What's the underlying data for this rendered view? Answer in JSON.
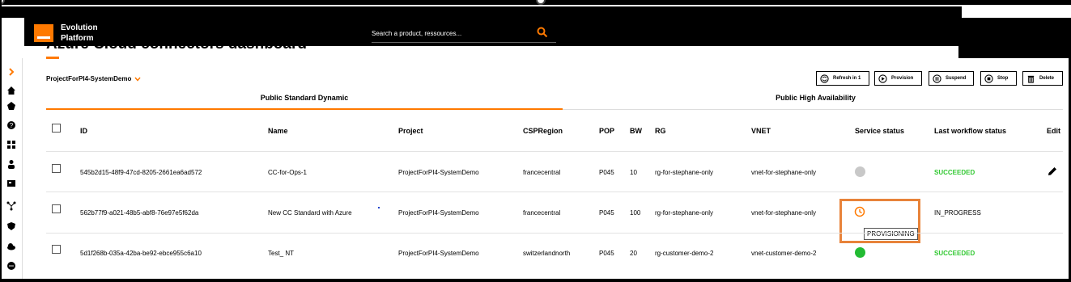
{
  "app": {
    "name_line1": "Evolution",
    "name_line2": "Platform",
    "search_placeholder": "Search a product, ressources..."
  },
  "page": {
    "title": "Azure Cloud connectors dashboard",
    "project": "ProjectForPI4-SystemDemo"
  },
  "actions": {
    "refresh": "Refresh in 1",
    "provision": "Provision",
    "suspend": "Suspend",
    "stop": "Stop",
    "delete": "Delete"
  },
  "tabs": [
    "Public Standard Dynamic",
    "Public High Availability"
  ],
  "table": {
    "headers": {
      "id": "ID",
      "name": "Name",
      "project": "Project",
      "region": "CSPRegion",
      "pop": "POP",
      "bw": "BW",
      "rg": "RG",
      "vnet": "VNET",
      "service_status": "Service status",
      "workflow_status": "Last workflow status",
      "edit": "Edit"
    },
    "rows": [
      {
        "id": "545b2d15-48f9-47cd-8205-2661ea6ad572",
        "name": "CC-for-Ops-1",
        "project": "ProjectForPI4-SystemDemo",
        "region": "francecentral",
        "pop": "P045",
        "bw": "10",
        "rg": "rg-for-stephane-only",
        "vnet": "vnet-for-stephane-only",
        "service_status_color": "#c8c8c8",
        "workflow_status": "SUCCEEDED"
      },
      {
        "id": "562b77f9-a021-48b5-abf8-76e97e5f62da",
        "name": "New CC Standard with Azure",
        "project": "ProjectForPI4-SystemDemo",
        "region": "francecentral",
        "pop": "P045",
        "bw": "100",
        "rg": "rg-for-stephane-only",
        "vnet": "vnet-for-stephane-only",
        "service_status_tooltip": "PROVISIONING",
        "workflow_status": "IN_PROGRESS"
      },
      {
        "id": "5d1f268b-035a-42ba-be92-ebce955c6a10",
        "name": "Test_ NT",
        "project": "ProjectForPI4-SystemDemo",
        "region": "switzerlandnorth",
        "pop": "P045",
        "bw": "20",
        "rg": "rg-customer-demo-2",
        "vnet": "vnet-customer-demo-2",
        "service_status_color": "#22bb33",
        "workflow_status": "SUCCEEDED"
      }
    ]
  },
  "colors": {
    "accent": "#ff7900",
    "success": "#32c832",
    "highlight": "#e8833a"
  }
}
